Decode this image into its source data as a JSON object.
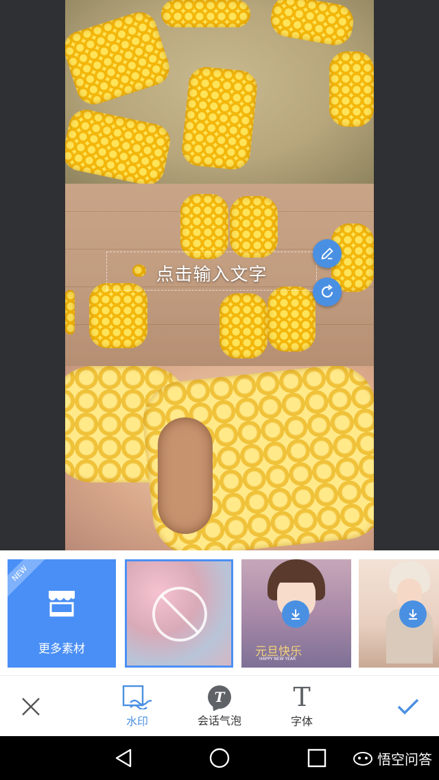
{
  "canvas": {
    "text_placeholder": "点击输入文字"
  },
  "icons": {
    "edit": "pencil-icon",
    "rotate": "rotate-icon",
    "store": "store-icon",
    "none": "no-symbol-icon",
    "download": "download-icon",
    "close": "close-icon",
    "watermark": "watermark-icon",
    "speech": "speech-bubble-icon",
    "font": "font-icon",
    "confirm": "check-icon",
    "back": "back-triangle-icon",
    "home": "home-circle-icon",
    "recents": "recents-square-icon"
  },
  "tray": {
    "more_materials_label": "更多素材",
    "new_badge": "NEW",
    "templates": [
      {
        "caption": "元旦快乐",
        "subcaption": "HAPPY NEW YEAR"
      },
      {
        "caption": ""
      }
    ]
  },
  "toolbar": {
    "watermark_label": "水印",
    "speech_bubble_label": "会话气泡",
    "font_label": "字体",
    "font_glyph": "T",
    "speech_glyph": "T"
  },
  "brand": {
    "watermark_text": "悟空问答"
  },
  "colors": {
    "accent": "#4a90e2",
    "tile_blue": "#4a8ff5"
  }
}
